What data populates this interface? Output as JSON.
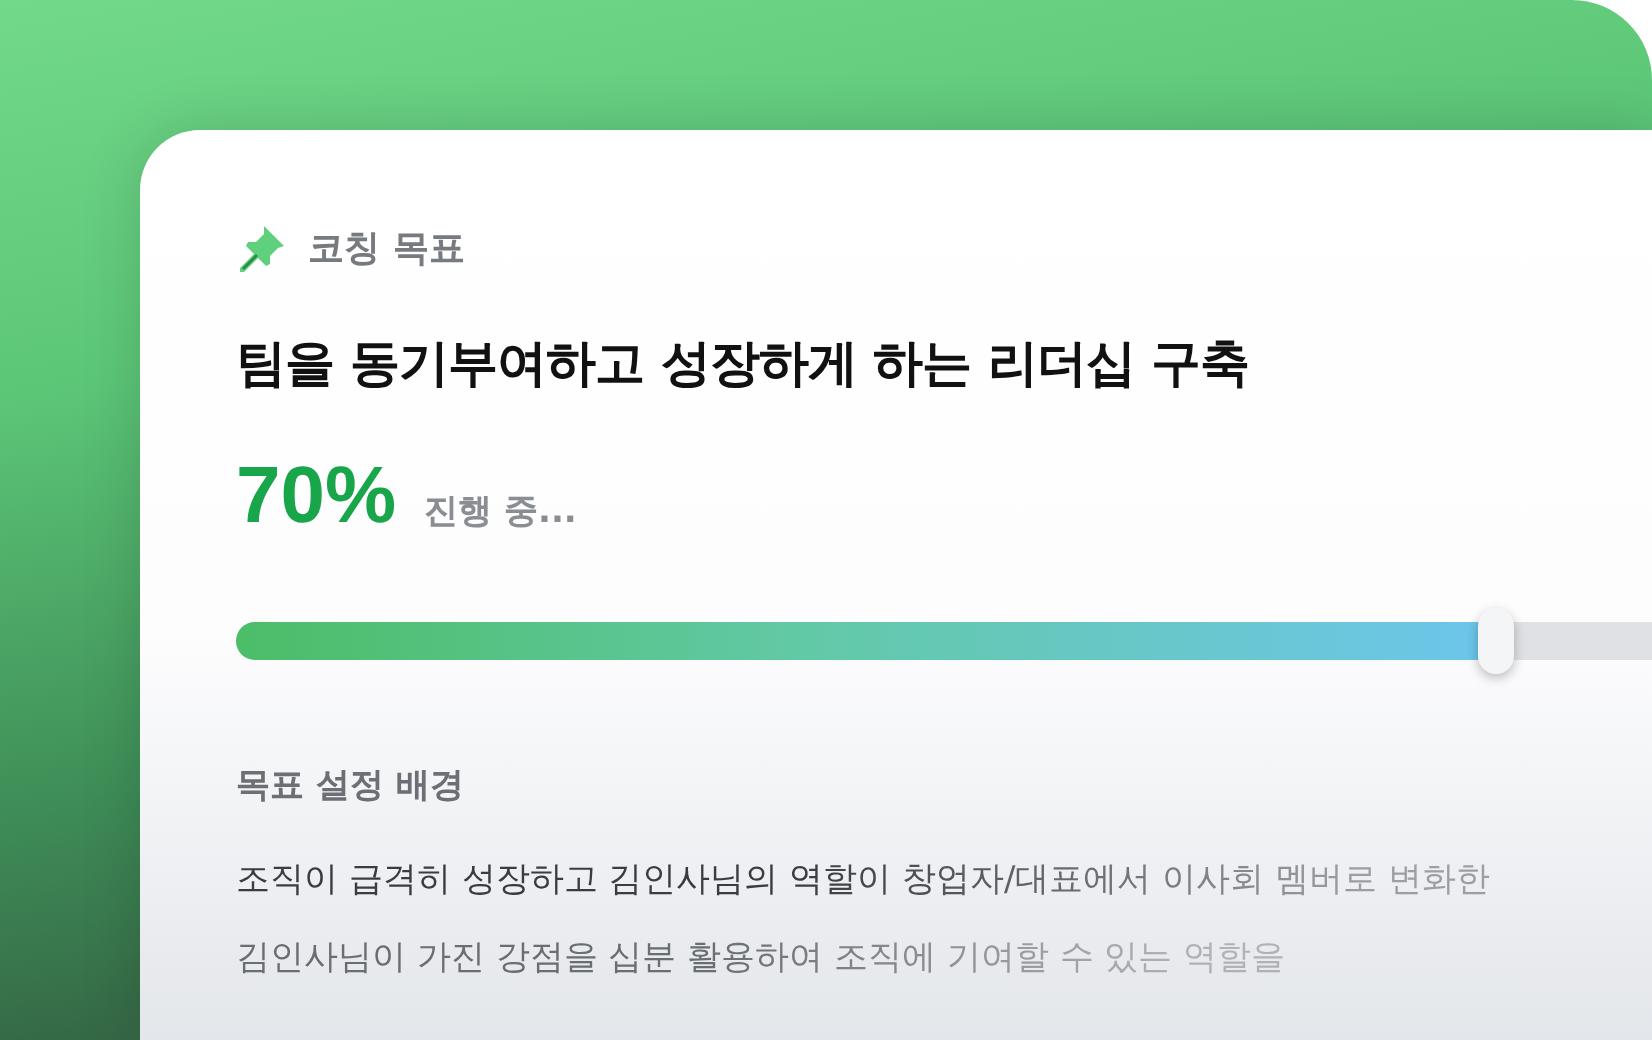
{
  "card": {
    "eyebrow": "코칭 목표",
    "title": "팀을 동기부여하고 성장하게 하는 리더십 구축",
    "percent": "70%",
    "status": "진행 중...",
    "progress": {
      "level": 0.89
    },
    "section_heading": "목표 설정 배경",
    "paragraph_lines": [
      "조직이 급격히 성장하고 김인사님의 역할이 창업자/대표에서 이사회 멤버로 변화한",
      "김인사님이 가진 강점을 십분 활용하여 조직에 기여할 수 있는 역할을"
    ]
  }
}
